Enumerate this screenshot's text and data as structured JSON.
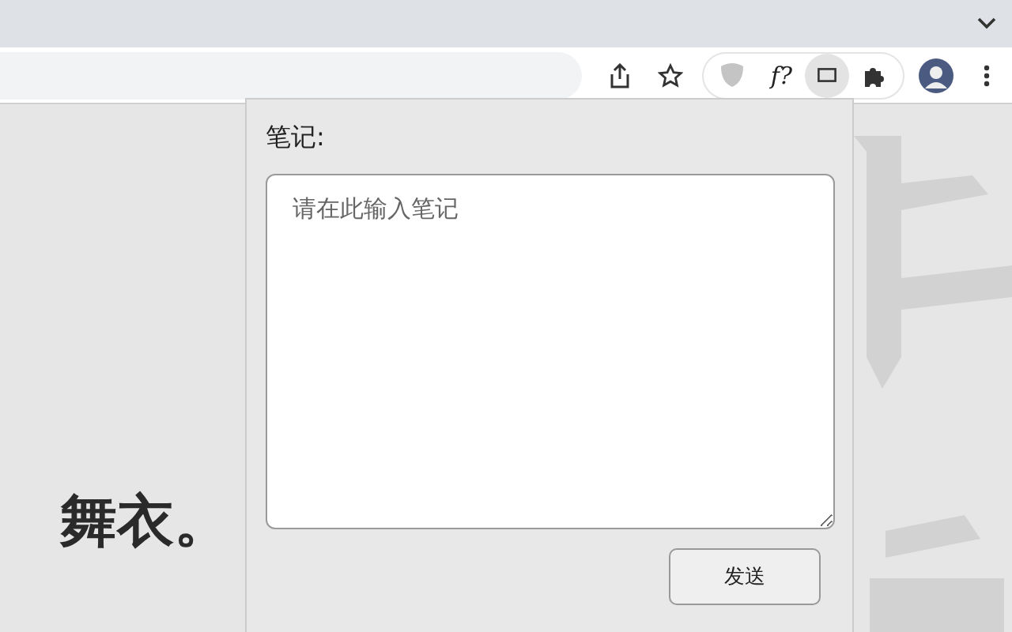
{
  "toolbar": {
    "extension_label": "f?"
  },
  "page": {
    "heading": "舞衣。"
  },
  "popup": {
    "label": "笔记:",
    "note": {
      "placeholder": "请在此输入笔记"
    },
    "send_button": "发送"
  }
}
